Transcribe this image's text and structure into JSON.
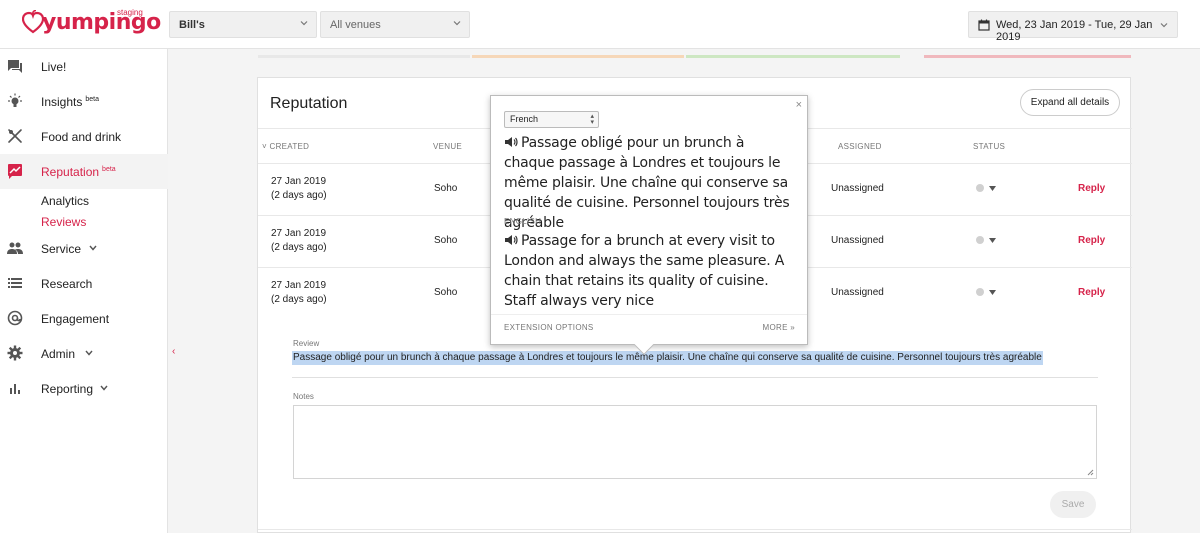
{
  "header": {
    "logo_text": "yumpingo",
    "logo_badge": "staging",
    "org_select": "Bill's",
    "venue_select": "All venues",
    "date_range": "Wed, 23 Jan 2019 - Tue, 29 Jan 2019"
  },
  "sidebar": {
    "items": [
      {
        "label": "Live!",
        "icon": "chat-icon"
      },
      {
        "label": "Insights",
        "badge": "beta",
        "icon": "lightbulb-icon"
      },
      {
        "label": "Food and drink",
        "icon": "cutlery-icon"
      },
      {
        "label": "Reputation",
        "badge": "beta",
        "icon": "reputation-icon"
      },
      {
        "label": "Service",
        "icon": "people-icon"
      },
      {
        "label": "Research",
        "icon": "list-icon"
      },
      {
        "label": "Engagement",
        "icon": "at-icon"
      },
      {
        "label": "Admin",
        "icon": "gear-icon"
      },
      {
        "label": "Reporting",
        "icon": "bar-chart-icon"
      }
    ],
    "sub_items": [
      "Analytics",
      "Reviews"
    ],
    "collapse_glyph": "‹"
  },
  "colors": {
    "brand": "#d6234a"
  },
  "reputation": {
    "title": "Reputation",
    "expand_label": "Expand all details",
    "columns": {
      "created": "CREATED",
      "venue": "VENUE",
      "assigned": "ASSIGNED",
      "status": "STATUS"
    },
    "rows": [
      {
        "date": "27 Jan 2019",
        "ago": "(2 days ago)",
        "venue": "Soho",
        "assigned": "Unassigned",
        "action": "Reply"
      },
      {
        "date": "27 Jan 2019",
        "ago": "(2 days ago)",
        "venue": "Soho",
        "assigned": "Unassigned",
        "action": "Reply"
      },
      {
        "date": "27 Jan 2019",
        "ago": "(2 days ago)",
        "venue": "Soho",
        "assigned": "Unassigned",
        "action": "Reply"
      }
    ],
    "expanded": {
      "review_label": "Review",
      "review_text": "Passage obligé pour un brunch à chaque passage à Londres et toujours le même plaisir. Une chaîne qui conserve sa qualité de cuisine. Personnel toujours très agréable",
      "notes_label": "Notes",
      "notes_value": "",
      "save_label": "Save"
    }
  },
  "translate_popup": {
    "source_language": "French",
    "source_text": "Passage obligé pour un brunch à chaque passage à Londres et toujours le même plaisir. Une chaîne qui conserve sa qualité de cuisine. Personnel toujours très agréable",
    "target_language_label": "ENGLISH",
    "translated_text": "Passage for a brunch at every visit to London and always the same pleasure. A chain that retains its quality of cuisine. Staff always very nice",
    "options_label": "EXTENSION OPTIONS",
    "more_label": "MORE »",
    "close_glyph": "×"
  }
}
